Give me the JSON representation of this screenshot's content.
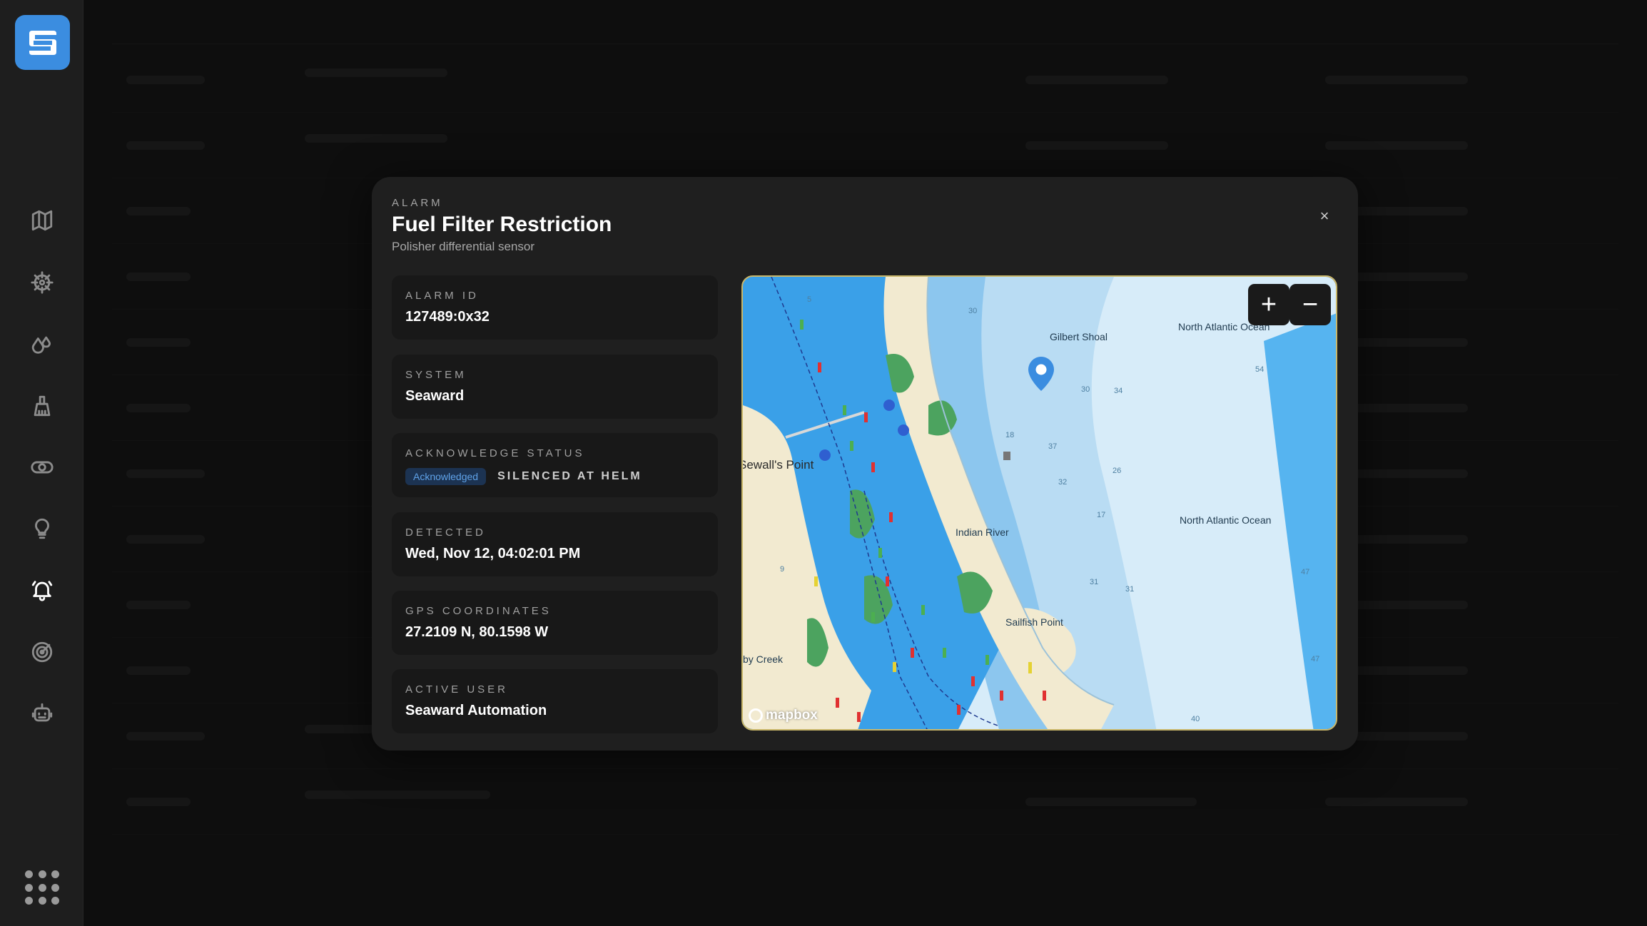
{
  "modal": {
    "eyebrow": "ALARM",
    "title": "Fuel Filter Restriction",
    "subtitle": "Polisher differential sensor",
    "close_label": "×"
  },
  "details": {
    "alarm_id": {
      "label": "ALARM ID",
      "value": "127489:0x32"
    },
    "system": {
      "label": "SYSTEM",
      "value": "Seaward"
    },
    "acknowledge": {
      "label": "ACKNOWLEDGE STATUS",
      "badge": "Acknowledged",
      "status": "SILENCED AT HELM"
    },
    "detected": {
      "label": "DETECTED",
      "value": "Wed, Nov 12, 04:02:01 PM"
    },
    "gps": {
      "label": "GPS COORDINATES",
      "value": "27.2109 N, 80.1598 W"
    },
    "active_user": {
      "label": "ACTIVE USER",
      "value": "Seaward Automation"
    }
  },
  "map": {
    "zoom_in": "+",
    "zoom_out": "−",
    "labels": {
      "gilbert": "Gilbert Shoal",
      "ocean_top": "North Atlantic Ocean",
      "ocean_mid": "North Atlantic Ocean",
      "sewalls": "Sewall's Point",
      "indian_river": "Indian River",
      "sailfish": "Sailfish Point",
      "creek": "by Creek"
    },
    "depths": [
      "30",
      "54",
      "34",
      "37",
      "26",
      "32",
      "17",
      "31",
      "31",
      "47",
      "47",
      "40",
      "18",
      "30",
      "9",
      "5"
    ],
    "attribution": "mapbox"
  },
  "sidebar": {
    "icons": [
      "map-icon",
      "helm-icon",
      "fluids-icon",
      "cleaning-icon",
      "toggle-icon",
      "lightbulb-icon",
      "alarm-bell-icon",
      "radar-icon",
      "robot-icon"
    ],
    "active": "alarm-bell-icon"
  },
  "colors": {
    "accent": "#3b8de0",
    "water": "#3aa0e8",
    "deep_water": "#cde6f7",
    "land": "#f2ead0",
    "vegetation": "#4ca35f"
  }
}
